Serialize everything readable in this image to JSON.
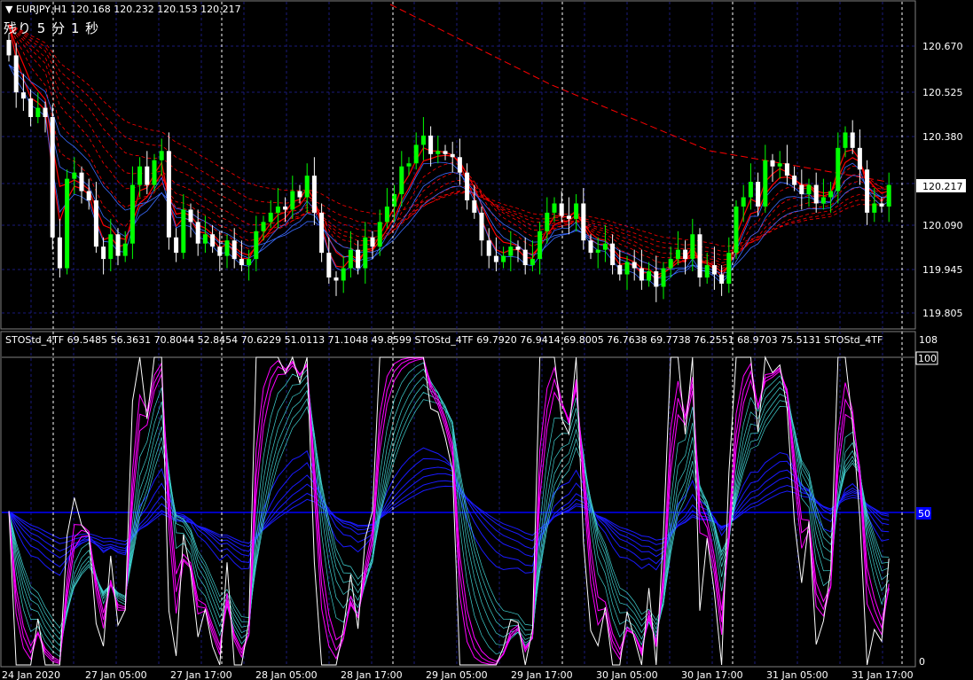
{
  "header": {
    "symbol_line": "▼ EURJPY,H1  120.168 120.232 120.153 120.217",
    "countdown": "残り 5 分 1 秒"
  },
  "price_axis": {
    "ticks": [
      "120.670",
      "120.525",
      "120.380",
      "120.090",
      "119.945",
      "119.805"
    ],
    "current_price": "120.217"
  },
  "indicator": {
    "header": "STOStd_4TF 69.5485 56.3631 70.8044 52.8454 70.6229 51.0113 71.1048 49.8599   STOStd_4TF 69.7920 76.9414 69.8005 76.7638 69.7738 76.2551 68.9703 75.5131   STOStd_4TF",
    "axis_top": "108",
    "axis_100": "100",
    "axis_50": "50",
    "axis_0": "0"
  },
  "time_axis": [
    "24 Jan 2020",
    "27 Jan 05:00",
    "27 Jan 17:00",
    "28 Jan 05:00",
    "28 Jan 17:00",
    "29 Jan 05:00",
    "29 Jan 17:00",
    "30 Jan 05:00",
    "30 Jan 17:00",
    "31 Jan 05:00",
    "31 Jan 17:00"
  ],
  "colors": {
    "bull_candle": "#00ff00",
    "bear_candle": "#ffffff",
    "ma_red": "#ff0000",
    "ma_blue": "#3b6cff",
    "stoch_magenta": "#ff00ff",
    "stoch_cyan": "#40d0d0",
    "stoch_blue": "#1a1aff",
    "grid": "#1a1a7a",
    "level_line": "#0000ff"
  },
  "chart_data": {
    "type": "candlestick",
    "title": "EURJPY,H1",
    "ylim": [
      119.78,
      120.74
    ],
    "candles_close": [
      120.64,
      120.52,
      120.5,
      120.44,
      120.47,
      120.44,
      120.05,
      119.95,
      120.24,
      120.26,
      120.2,
      120.17,
      120.02,
      119.98,
      120.06,
      119.99,
      120.03,
      120.22,
      120.28,
      120.22,
      120.3,
      120.33,
      120.05,
      120.0,
      120.14,
      120.1,
      120.03,
      120.06,
      120.02,
      119.99,
      120.04,
      119.98,
      119.96,
      119.98,
      120.07,
      120.1,
      120.13,
      120.15,
      120.14,
      120.2,
      120.18,
      120.25,
      120.13,
      120.0,
      119.92,
      119.91,
      119.95,
      120.01,
      119.95,
      120.05,
      120.02,
      120.1,
      120.15,
      120.19,
      120.28,
      120.29,
      120.35,
      120.38,
      120.32,
      120.33,
      120.32,
      120.31,
      120.26,
      120.17,
      120.13,
      120.04,
      119.99,
      119.97,
      119.99,
      120.02,
      120.01,
      119.96,
      119.98,
      120.07,
      120.13,
      120.16,
      120.12,
      120.11,
      120.16,
      120.04,
      120.0,
      120.01,
      120.03,
      119.96,
      119.93,
      119.97,
      119.95,
      119.91,
      119.94,
      119.89,
      119.95,
      119.98,
      120.01,
      119.98,
      120.06,
      119.92,
      119.96,
      119.93,
      119.9,
      120.0,
      120.15,
      120.18,
      120.23,
      120.15,
      120.3,
      120.28,
      120.29,
      120.25,
      120.22,
      120.19,
      120.22,
      120.16,
      120.18,
      120.2,
      120.34,
      120.39,
      120.34,
      120.27,
      120.13,
      120.16,
      120.15,
      120.22
    ]
  }
}
